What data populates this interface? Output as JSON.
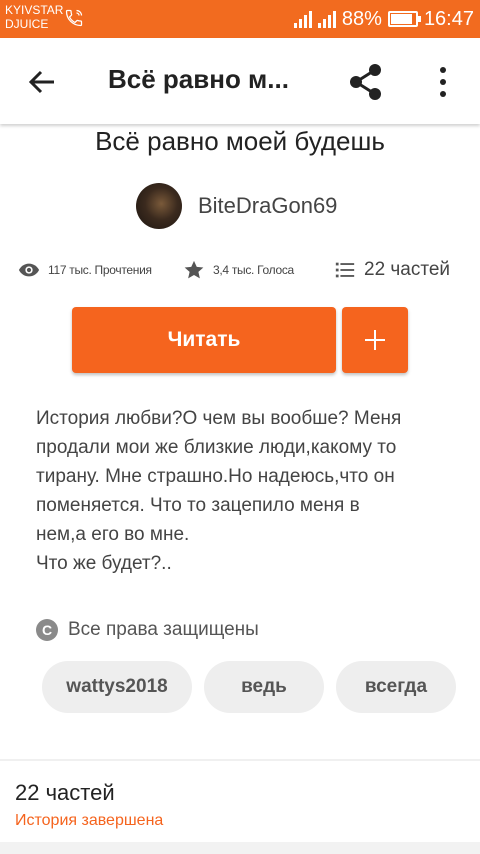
{
  "status_bar": {
    "carrier_line1": "KYIVSTAR",
    "carrier_line2": "DJUICE",
    "battery_percent": "88%",
    "battery_level": 0.88,
    "time": "16:47",
    "background_color": "#f26b1f"
  },
  "app_bar": {
    "back_icon": "arrow-left-icon",
    "title": "Всё равно м...",
    "share_icon": "share-icon",
    "more_icon": "more-vertical-icon"
  },
  "story": {
    "title": "Всё равно моей будешь",
    "author": "BiteDraGon69",
    "stats": {
      "reads": "117 тыс. Прочтения",
      "votes": "3,4 тыс. Голоса",
      "parts": "22 частей"
    },
    "read_button": "Читать",
    "add_button_icon": "plus-icon",
    "description_lines": [
      "История любви?О чем вы вообше? Меня",
      "продали мои же близкие люди,какому то",
      "тирану. Мне страшно.Но надеюсь,что он",
      "поменяется. Что то зацепило меня в",
      "нем,а его во мне.",
      "Что же будет?.."
    ],
    "copyright_icon": "copyright-icon",
    "copyright": "Все права защищены",
    "tags": [
      "wattys2018",
      "ведь",
      "всегда"
    ],
    "parts_count": "22 частей",
    "status": "История завершена"
  },
  "colors": {
    "accent": "#f5641e",
    "text_primary": "#222222",
    "text_secondary": "#444444",
    "tag_background": "#eeeeee"
  }
}
